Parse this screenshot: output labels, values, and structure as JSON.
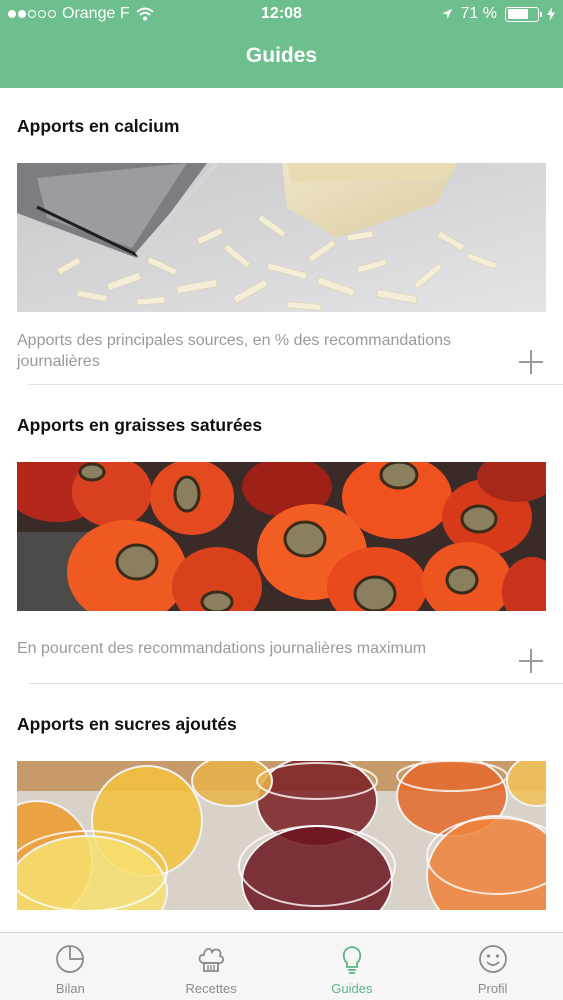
{
  "status_bar": {
    "carrier": "Orange F",
    "time": "12:08",
    "battery": "71 %",
    "battery_level": 0.71,
    "signal_bars": 2,
    "signal_total": 5
  },
  "nav": {
    "title": "Guides"
  },
  "sections": [
    {
      "title": "Apports en calcium",
      "image_icon": "grated-cheese-photo",
      "description": "Apports des principales sources, en % des recommandations journalières"
    },
    {
      "title": "Apports en graisses saturées",
      "image_icon": "palm-fruit-photo",
      "description": "En pourcent des recommandations journalières maximum"
    },
    {
      "title": "Apports en sucres ajoutés",
      "image_icon": "juice-glasses-photo",
      "description": ""
    }
  ],
  "tabs": [
    {
      "label": "Bilan",
      "icon": "pie-chart-icon"
    },
    {
      "label": "Recettes",
      "icon": "chef-hat-icon"
    },
    {
      "label": "Guides",
      "icon": "lightbulb-icon",
      "active": true
    },
    {
      "label": "Profil",
      "icon": "smiley-icon"
    }
  ],
  "colors": {
    "accent": "#6dbf8d",
    "active_tab": "#5cb683",
    "muted_text": "#9a9a9a"
  }
}
